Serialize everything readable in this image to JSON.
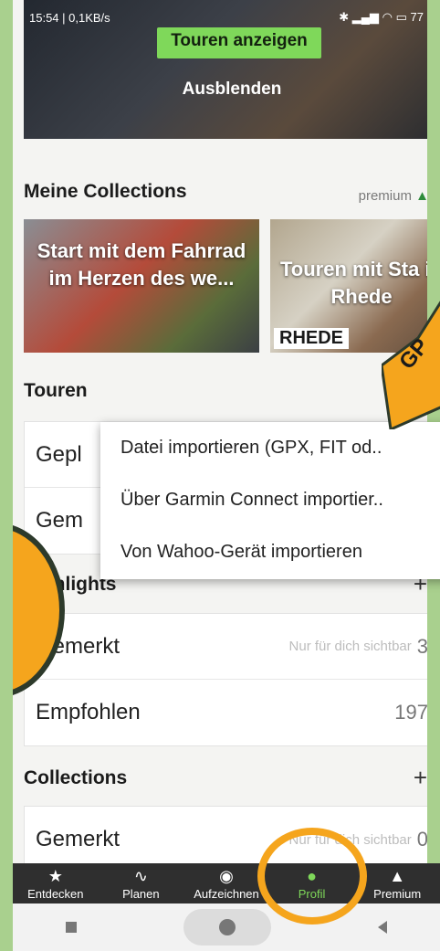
{
  "status_bar": {
    "left": "15:54 | 0,1KB/s",
    "right_icons": "bluetooth, signal, wifi",
    "battery": "77"
  },
  "hero": {
    "cta_label": "Touren anzeigen",
    "hide_label": "Ausblenden"
  },
  "collections_section": {
    "title": "Meine Collections",
    "premium_label": "premium",
    "cards": [
      {
        "title": "Start mit dem Fahrrad im Herzen des we..."
      },
      {
        "title": "Touren mit Sta in Rhede",
        "badge": "RHEDE"
      }
    ]
  },
  "tours_section": {
    "title": "Touren",
    "rows": [
      {
        "label": "Gepl"
      },
      {
        "label": "Gem"
      }
    ]
  },
  "import_menu": {
    "items": [
      "Datei importieren (GPX, FIT od..",
      "Über Garmin Connect importier..",
      "Von Wahoo-Gerät importieren"
    ]
  },
  "highlights_section": {
    "title": "ighlights",
    "rows": [
      {
        "label": "Gemerkt",
        "hint": "Nur für dich sichtbar",
        "count": "3"
      },
      {
        "label": "Empfohlen",
        "hint": "",
        "count": "197"
      }
    ]
  },
  "collections_list_section": {
    "title": "Collections",
    "rows": [
      {
        "label": "Gemerkt",
        "hint": "Nur für dich sichtbar",
        "count": "0"
      }
    ]
  },
  "overlay_arrow_text": "GP",
  "bottom_nav": {
    "items": [
      {
        "label": "Entdecken",
        "icon": "star-icon"
      },
      {
        "label": "Planen",
        "icon": "route-icon"
      },
      {
        "label": "Aufzeichnen",
        "icon": "record-icon"
      },
      {
        "label": "Profil",
        "icon": "person-icon",
        "active": true
      },
      {
        "label": "Premium",
        "icon": "premium-icon"
      }
    ]
  },
  "colors": {
    "accent_green": "#7fd85a",
    "annotation_orange": "#f5a51d",
    "nav_bg": "#2f2f2f"
  }
}
